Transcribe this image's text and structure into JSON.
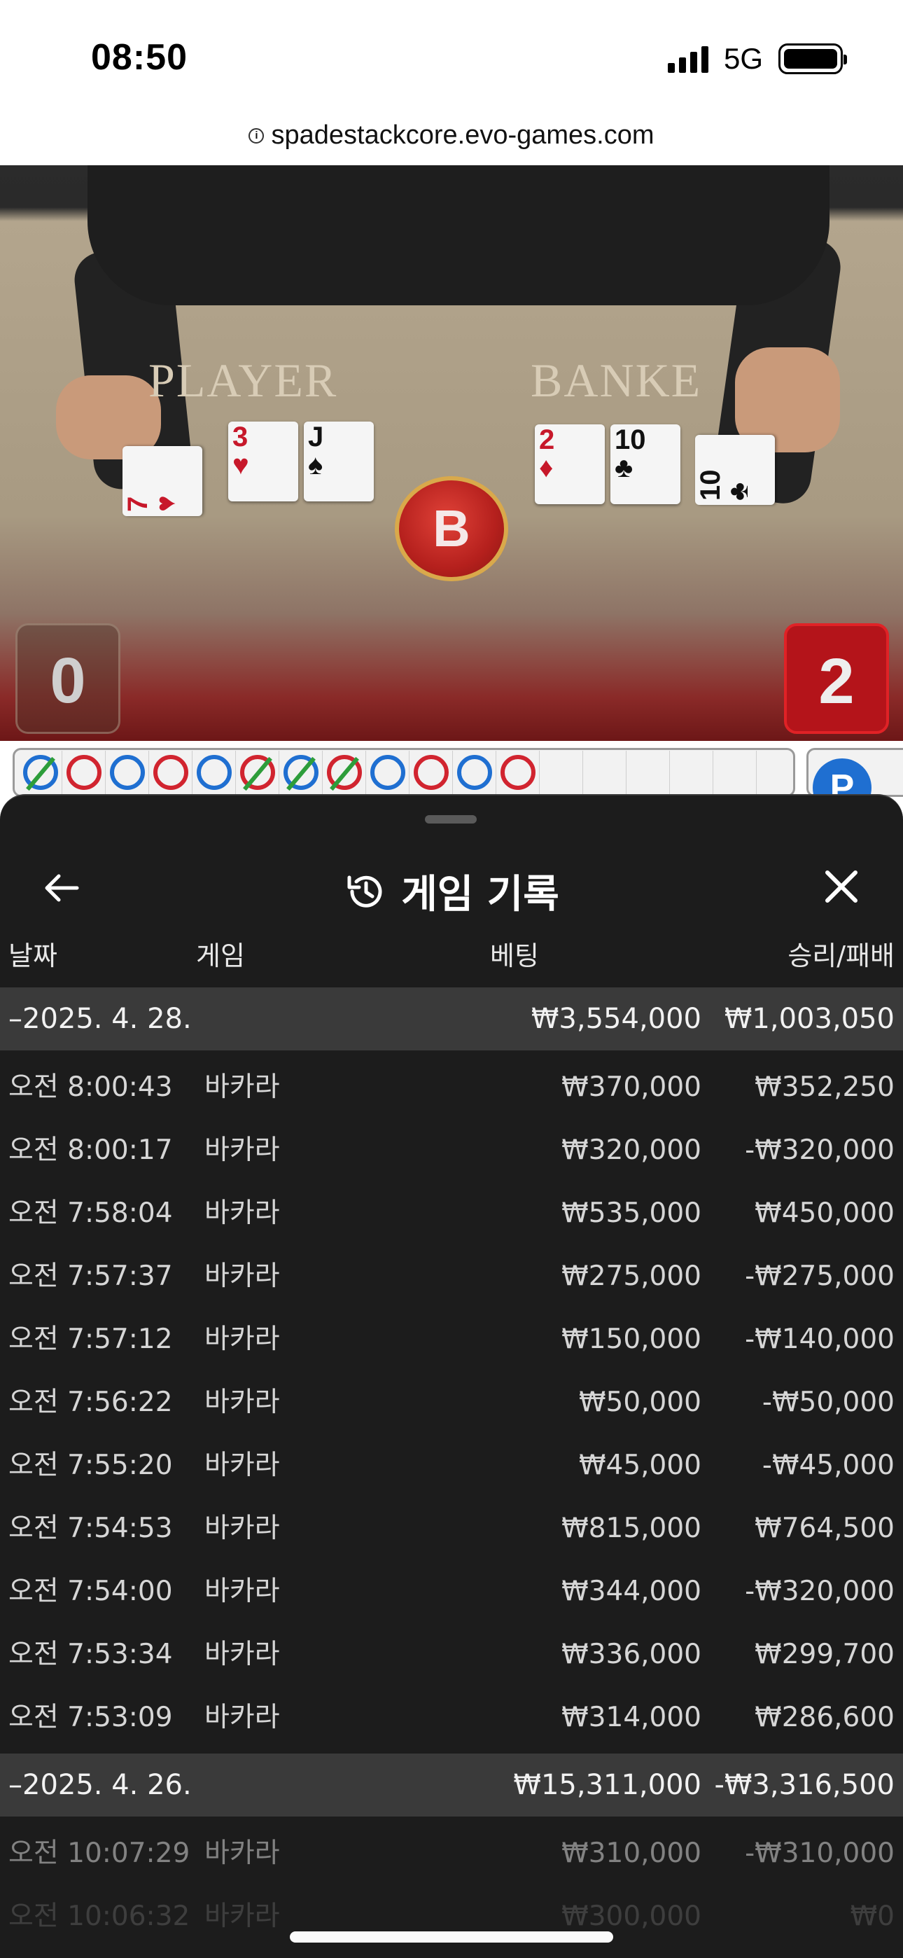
{
  "status_bar": {
    "time": "08:50",
    "network": "5G"
  },
  "browser": {
    "url": "spadestackcore.evo-games.com",
    "info_icon": "ⓘ"
  },
  "video": {
    "player_label": "PLAYER",
    "banker_label": "BANKE",
    "player_score": "0",
    "banker_score": "2",
    "winner_badge": "B",
    "player_cards": [
      {
        "rank": "7",
        "suit": "♥",
        "color": "red"
      },
      {
        "rank": "3",
        "suit": "♥",
        "color": "red"
      },
      {
        "rank": "J",
        "suit": "♠",
        "color": "black"
      }
    ],
    "banker_cards": [
      {
        "rank": "2",
        "suit": "♦",
        "color": "red"
      },
      {
        "rank": "10",
        "suit": "♣",
        "color": "black"
      },
      {
        "rank": "10",
        "suit": "♣",
        "color": "black"
      }
    ]
  },
  "road": {
    "entries": [
      "blue-slash",
      "red",
      "blue",
      "red",
      "blue",
      "red-slash",
      "blue-slash",
      "red-slash",
      "blue",
      "red",
      "blue",
      "red"
    ],
    "side_badge": "P"
  },
  "sheet": {
    "title": "게임 기록",
    "columns": {
      "date": "날짜",
      "game": "게임",
      "bet": "베팅",
      "winloss": "승리/패배"
    },
    "groups": [
      {
        "date": "–2025. 4. 28.",
        "bet_total": "₩3,554,000",
        "winloss_total": "₩1,003,050",
        "rows": [
          {
            "time": "오전 8:00:43",
            "game": "바카라",
            "bet": "₩370,000",
            "winloss": "₩352,250"
          },
          {
            "time": "오전 8:00:17",
            "game": "바카라",
            "bet": "₩320,000",
            "winloss": "-₩320,000"
          },
          {
            "time": "오전 7:58:04",
            "game": "바카라",
            "bet": "₩535,000",
            "winloss": "₩450,000"
          },
          {
            "time": "오전 7:57:37",
            "game": "바카라",
            "bet": "₩275,000",
            "winloss": "-₩275,000"
          },
          {
            "time": "오전 7:57:12",
            "game": "바카라",
            "bet": "₩150,000",
            "winloss": "-₩140,000"
          },
          {
            "time": "오전 7:56:22",
            "game": "바카라",
            "bet": "₩50,000",
            "winloss": "-₩50,000"
          },
          {
            "time": "오전 7:55:20",
            "game": "바카라",
            "bet": "₩45,000",
            "winloss": "-₩45,000"
          },
          {
            "time": "오전 7:54:53",
            "game": "바카라",
            "bet": "₩815,000",
            "winloss": "₩764,500"
          },
          {
            "time": "오전 7:54:00",
            "game": "바카라",
            "bet": "₩344,000",
            "winloss": "-₩320,000"
          },
          {
            "time": "오전 7:53:34",
            "game": "바카라",
            "bet": "₩336,000",
            "winloss": "₩299,700"
          },
          {
            "time": "오전 7:53:09",
            "game": "바카라",
            "bet": "₩314,000",
            "winloss": "₩286,600"
          }
        ]
      },
      {
        "date": "–2025. 4. 26.",
        "bet_total": "₩15,311,000",
        "winloss_total": "-₩3,316,500",
        "rows": [
          {
            "time": "오전 10:07:29",
            "game": "바카라",
            "bet": "₩310,000",
            "winloss": "-₩310,000"
          },
          {
            "time": "오전 10:06:32",
            "game": "바카라",
            "bet": "₩300,000",
            "winloss": "₩0"
          }
        ]
      }
    ]
  },
  "colors": {
    "sheet_bg": "#1c1c1c",
    "date_row_bg": "#3a3a3a",
    "banker_red": "#b4141a",
    "player_blue": "#1f6fd1",
    "tie_green": "#2d9d3a"
  }
}
